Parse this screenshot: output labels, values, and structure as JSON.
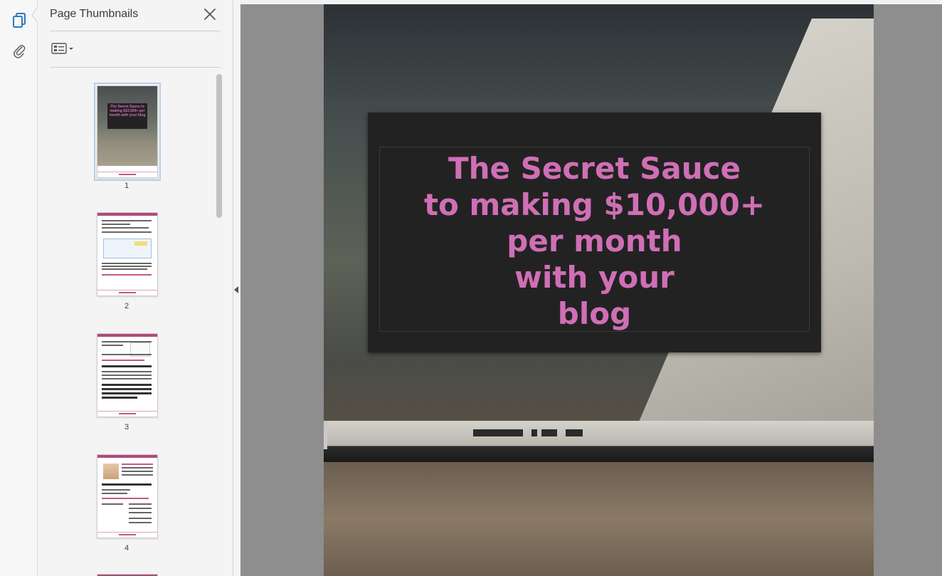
{
  "panel": {
    "title": "Page Thumbnails",
    "thumbnails": [
      {
        "page": "1"
      },
      {
        "page": "2"
      },
      {
        "page": "3"
      },
      {
        "page": "4"
      }
    ]
  },
  "document": {
    "title_lines": [
      "The Secret Sauce",
      "to making $10,000+",
      "per month",
      "with your",
      "blog"
    ]
  },
  "thumbnail_cover_text": "The Secret Sauce to making $10,000+ per month with your blog",
  "icons": {
    "rail_top": "page-thumbnails-icon",
    "rail_second": "attachments-icon",
    "close": "close-icon",
    "options": "thumbnail-options-icon",
    "collapse": "collapse-arrow-icon"
  },
  "colors": {
    "accent_blue": "#2f78c4",
    "title_pink": "#cf6fb5",
    "title_box": "#232223"
  }
}
